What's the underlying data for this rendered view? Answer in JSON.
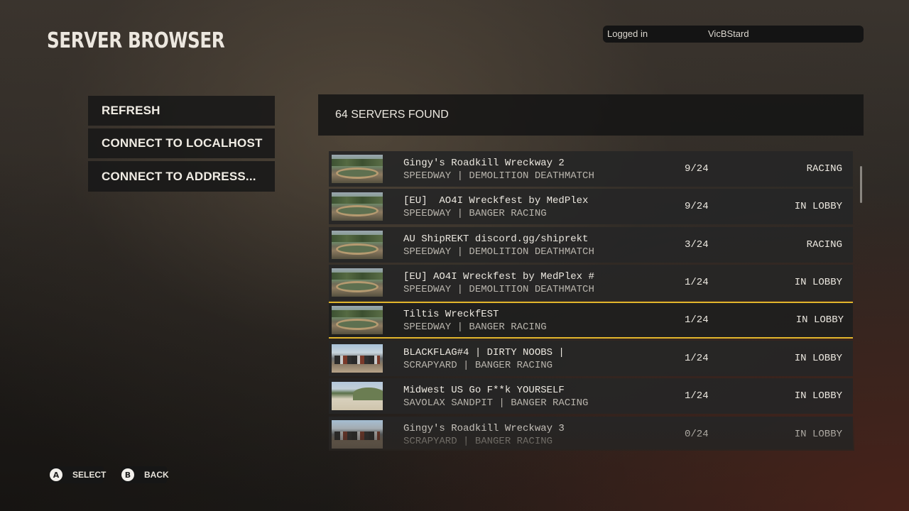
{
  "header": {
    "title": "SERVER BROWSER"
  },
  "login": {
    "label": "Logged in",
    "username": "VicBStard"
  },
  "menu": {
    "refresh": "REFRESH",
    "connect_localhost": "CONNECT TO LOCALHOST",
    "connect_address": "CONNECT TO ADDRESS..."
  },
  "server_list": {
    "count_text": "64 SERVERS FOUND",
    "rows": [
      {
        "name": "Gingy's Roadkill Wreckway 2",
        "mode": "SPEEDWAY | DEMOLITION DEATHMATCH",
        "players": "9/24",
        "status": "RACING",
        "thumb": "speedway"
      },
      {
        "name": "[EU]  AO4I Wreckfest by MedPlex",
        "mode": "SPEEDWAY | BANGER RACING",
        "players": "9/24",
        "status": "IN LOBBY",
        "thumb": "speedway"
      },
      {
        "name": "AU ShipREKT discord.gg/shiprekt",
        "mode": "SPEEDWAY | DEMOLITION DEATHMATCH",
        "players": "3/24",
        "status": "RACING",
        "thumb": "speedway"
      },
      {
        "name": "[EU] AO4I Wreckfest by MedPlex #",
        "mode": "SPEEDWAY | DEMOLITION DEATHMATCH",
        "players": "1/24",
        "status": "IN LOBBY",
        "thumb": "speedway"
      },
      {
        "name": "Tiltis WreckfEST",
        "mode": "SPEEDWAY | BANGER RACING",
        "players": "1/24",
        "status": "IN LOBBY",
        "thumb": "speedway",
        "selected": true
      },
      {
        "name": "BLACKFLAG#4 | DIRTY NOOBS |",
        "mode": "SCRAPYARD | BANGER RACING",
        "players": "1/24",
        "status": "IN LOBBY",
        "thumb": "scrapyard"
      },
      {
        "name": "Midwest US Go F**k YOURSELF",
        "mode": "SAVOLAX SANDPIT | BANGER RACING",
        "players": "1/24",
        "status": "IN LOBBY",
        "thumb": "sandpit"
      },
      {
        "name": "Gingy's Roadkill Wreckway 3",
        "mode": "SCRAPYARD | BANGER RACING",
        "players": "0/24",
        "status": "IN LOBBY",
        "thumb": "scrapyard"
      }
    ]
  },
  "footer": {
    "select": {
      "glyph": "A",
      "label": "SELECT"
    },
    "back": {
      "glyph": "B",
      "label": "BACK"
    }
  }
}
